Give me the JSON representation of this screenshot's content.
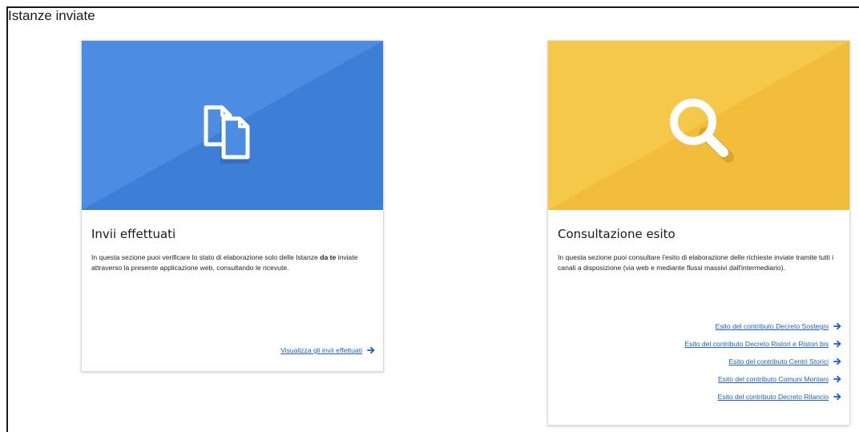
{
  "page": {
    "title": "Istanze inviate"
  },
  "colors": {
    "blue_card": "#4a8be0",
    "yellow_card": "#f5c445",
    "link": "#1c5fcf"
  },
  "cards": [
    {
      "icon": "documents-icon",
      "title": "Invii effettuati",
      "desc_pre": "In questa sezione puoi verificare lo stato di elaborazione solo delle Istanze ",
      "desc_bold": "da te",
      "desc_post": " inviate attraverso la presente applicazione web, consultando le ricevute.",
      "links": [
        {
          "label": "Visualizza gli invii effettuati",
          "icon": "arrow-right-icon"
        }
      ]
    },
    {
      "icon": "search-icon",
      "title": "Consultazione esito",
      "desc": "In questa sezione puoi consultare l'esito di elaborazione delle richieste inviate tramite tutti i canali a disposizione (via web e mediante flussi massivi dall'intermediario).",
      "links": [
        {
          "label": "Esito del contributo Decreto Sostegni",
          "icon": "arrow-right-icon"
        },
        {
          "label": "Esito del contributo Decreto Ristori e Ristori bis",
          "icon": "arrow-right-icon"
        },
        {
          "label": "Esito del contributo Centri Storici",
          "icon": "arrow-right-icon"
        },
        {
          "label": "Esito del contributo Comuni Montani",
          "icon": "arrow-right-icon"
        },
        {
          "label": "Esito del contributo Decreto Rilancio",
          "icon": "arrow-right-icon"
        }
      ]
    }
  ]
}
